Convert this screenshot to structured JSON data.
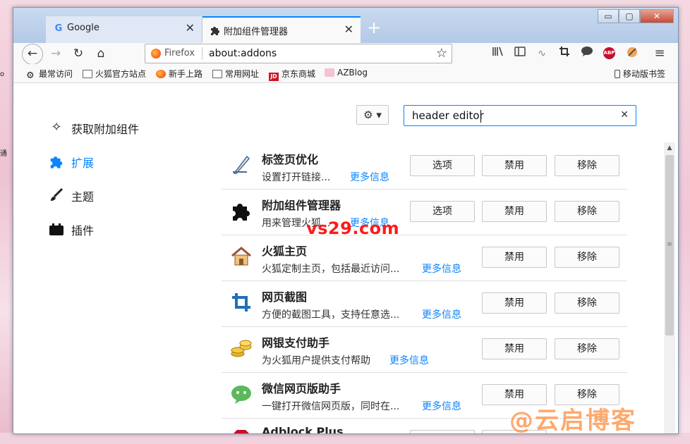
{
  "window": {
    "controls": {
      "minimize": "▭",
      "maximize": "▢",
      "close": "✕"
    }
  },
  "desktop": {
    "left_text": [
      "o",
      "通"
    ]
  },
  "tabs": [
    {
      "title": "Google",
      "favicon": "G",
      "close": "✕"
    },
    {
      "title": "附加组件管理器",
      "close": "✕"
    }
  ],
  "new_tab": "+",
  "nav": {
    "back": "←",
    "forward": "→",
    "reload": "↻",
    "home": "⌂",
    "brand": "Firefox",
    "url": "about:addons",
    "star": "☆",
    "menu": "≡"
  },
  "bookmarks": [
    {
      "label": "最常访问"
    },
    {
      "label": "火狐官方站点"
    },
    {
      "label": "新手上路"
    },
    {
      "label": "常用网址"
    },
    {
      "label": "京东商城",
      "icon_text": "JD"
    },
    {
      "label": "AZBlog"
    }
  ],
  "mobile_bookmarks": "移动版书签",
  "categories": [
    {
      "label": "获取附加组件"
    },
    {
      "label": "扩展"
    },
    {
      "label": "主题"
    },
    {
      "label": "插件"
    }
  ],
  "search": {
    "value": "header editor",
    "clear": "✕"
  },
  "gear": "⚙ ▾",
  "addons": [
    {
      "name": "标签页优化",
      "desc": "设置打开链接...",
      "more": "更多信息",
      "options": "选项",
      "disable": "禁用",
      "remove": "移除"
    },
    {
      "name": "附加组件管理器",
      "desc": "用来管理火狐...",
      "more": "更多信息",
      "options": "选项",
      "disable": "禁用",
      "remove": "移除"
    },
    {
      "name": "火狐主页",
      "desc": "火狐定制主页，包括最近访问...",
      "more": "更多信息",
      "disable": "禁用",
      "remove": "移除"
    },
    {
      "name": "网页截图",
      "desc": "方便的截图工具，支持任意选...",
      "more": "更多信息",
      "disable": "禁用",
      "remove": "移除"
    },
    {
      "name": "网银支付助手",
      "desc": "为火狐用户提供支付帮助",
      "more": "更多信息",
      "disable": "禁用",
      "remove": "移除"
    },
    {
      "name": "微信网页版助手",
      "desc": "一键打开微信网页版，同时在...",
      "more": "更多信息",
      "disable": "禁用",
      "remove": "移除"
    },
    {
      "name": "Adblock Plus"
    }
  ],
  "watermarks": {
    "site": "vs29.com",
    "blog": "@云启博客"
  }
}
